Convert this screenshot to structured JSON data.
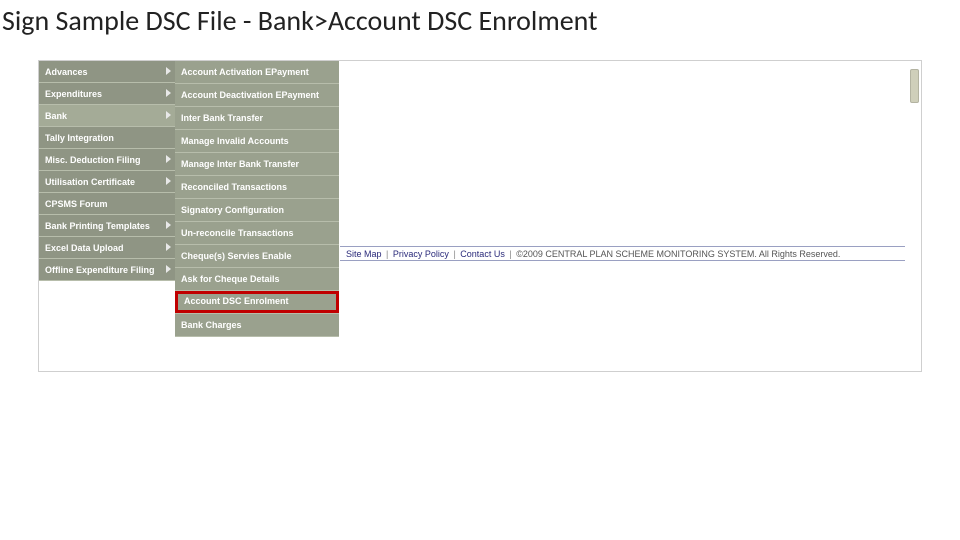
{
  "title": "Sign Sample DSC File - Bank>Account DSC Enrolment",
  "sidebar": {
    "items": [
      {
        "label": "Advances",
        "arrow": true,
        "selected": false
      },
      {
        "label": "Expenditures",
        "arrow": true,
        "selected": false
      },
      {
        "label": "Bank",
        "arrow": true,
        "selected": true
      },
      {
        "label": "Tally Integration",
        "arrow": false,
        "selected": false
      },
      {
        "label": "Misc. Deduction Filing",
        "arrow": true,
        "selected": false
      },
      {
        "label": "Utilisation Certificate",
        "arrow": true,
        "selected": false
      },
      {
        "label": "CPSMS Forum",
        "arrow": false,
        "selected": false
      },
      {
        "label": "Bank Printing Templates",
        "arrow": true,
        "selected": false
      },
      {
        "label": "Excel Data Upload",
        "arrow": true,
        "selected": false
      },
      {
        "label": "Offline Expenditure Filing",
        "arrow": true,
        "selected": false
      }
    ]
  },
  "submenu": {
    "items": [
      {
        "label": "Account Activation EPayment"
      },
      {
        "label": "Account Deactivation EPayment"
      },
      {
        "label": "Inter Bank Transfer"
      },
      {
        "label": "Manage Invalid Accounts"
      },
      {
        "label": "Manage Inter Bank Transfer"
      },
      {
        "label": "Reconciled Transactions"
      },
      {
        "label": "Signatory Configuration"
      },
      {
        "label": "Un-reconcile Transactions"
      },
      {
        "label": "Cheque(s) Servies Enable"
      },
      {
        "label": "Ask for Cheque Details"
      },
      {
        "label": "Account DSC Enrolment",
        "highlight": true
      },
      {
        "label": "Bank Charges"
      }
    ]
  },
  "footer": {
    "links": [
      "Site Map",
      "Privacy Policy",
      "Contact Us"
    ],
    "sep": "|",
    "copyright": "©2009 CENTRAL PLAN SCHEME MONITORING SYSTEM. All Rights Reserved."
  }
}
